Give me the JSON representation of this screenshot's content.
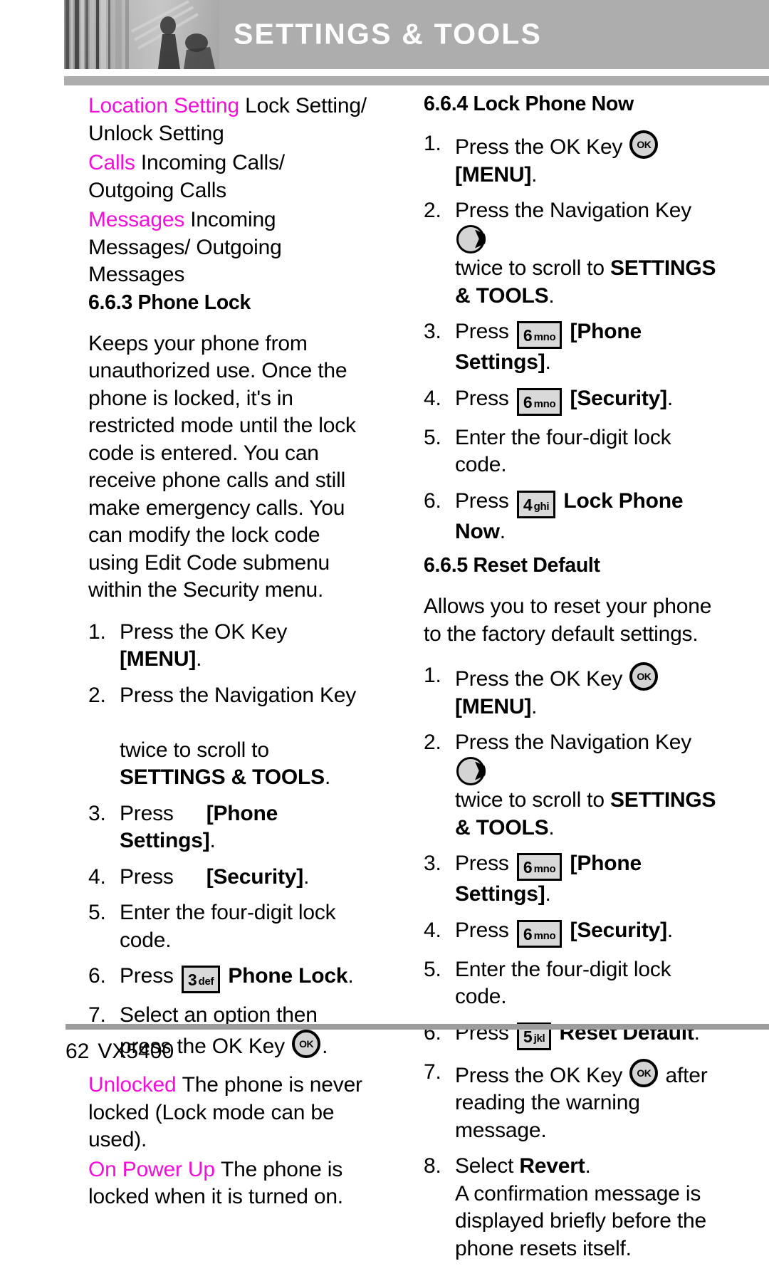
{
  "header": {
    "title": "SETTINGS & TOOLS",
    "photo_alt": "grayscale-photo"
  },
  "left_column": {
    "terms": [
      {
        "term": "Location Setting",
        "definition": "Lock Setting/ Unlock Setting"
      },
      {
        "term": "Calls",
        "definition": "Incoming Calls/ Outgoing Calls"
      },
      {
        "term": "Messages",
        "definition": "Incoming Messages/ Outgoing Messages"
      }
    ],
    "section": {
      "heading": "6.6.3 Phone Lock",
      "body": "Keeps your phone from unauthorized use. Once the phone is locked, it's in restricted mode until the lock code is entered. You can receive phone calls and still make emergency calls. You can modify the lock code using Edit Code submenu within the Security menu.",
      "steps": [
        {
          "num": "1.",
          "pre": "Press the OK Key",
          "icon": "missing-ok-key-icon",
          "post": "[MENU]",
          "post_bold": "[MENU]",
          "tail": "."
        },
        {
          "num": "2.",
          "pre": "Press the Navigation Key",
          "icon": "missing-navigation-key-icon",
          "post": "twice to scroll to",
          "bold_run": "SETTINGS & TOOLS",
          "tail": "."
        },
        {
          "num": "3.",
          "pre": "Press",
          "icon": "missing-key-6-icon",
          "post_bold": "[Phone Settings]",
          "tail": "."
        },
        {
          "num": "4.",
          "pre": "Press",
          "icon": "missing-key-6-icon",
          "post_bold": "[Security]",
          "tail": "."
        },
        {
          "num": "5.",
          "pre": "Enter the four-digit lock code.",
          "icon": "",
          "post_bold": "",
          "tail": ""
        },
        {
          "num": "6.",
          "pre": "Press",
          "icon": "key-3-def",
          "key_digit": "3",
          "key_letters": "def",
          "post_bold": "Phone Lock",
          "tail": "."
        },
        {
          "num": "7.",
          "pre": "Select an option then press the OK Key",
          "icon": "ok-key",
          "post_bold": "",
          "tail": "."
        }
      ]
    },
    "options": [
      {
        "term": "Unlocked",
        "definition": "The phone is never locked (Lock mode can be used)."
      },
      {
        "term": "On Power Up",
        "definition": "The phone is locked when it is turned on."
      }
    ]
  },
  "right_column": {
    "section_lock": {
      "heading": "6.6.4 Lock Phone Now",
      "steps": [
        {
          "num": "1.",
          "pre": "Press the OK Key",
          "icon": "ok-key",
          "post_bold": "[MENU]",
          "tail": "."
        },
        {
          "num": "2.",
          "pre": "Press the Navigation Key",
          "icon": "navigation-key",
          "post": "twice to scroll to",
          "bold_run": "SETTINGS & TOOLS",
          "tail": "."
        },
        {
          "num": "3.",
          "pre": "Press",
          "icon": "key-6-mno",
          "key_digit": "6",
          "key_letters": "mno",
          "post_bold": "[Phone Settings]",
          "tail": "."
        },
        {
          "num": "4.",
          "pre": "Press",
          "icon": "key-6-mno",
          "key_digit": "6",
          "key_letters": "mno",
          "post_bold": "[Security]",
          "tail": "."
        },
        {
          "num": "5.",
          "pre": "Enter the four-digit lock code.",
          "icon": "",
          "post_bold": "",
          "tail": ""
        },
        {
          "num": "6.",
          "pre": "Press",
          "icon": "key-4-ghi",
          "key_digit": "4",
          "key_letters": "ghi",
          "post_bold": "Lock Phone Now",
          "tail": "."
        }
      ]
    },
    "section_reset": {
      "heading": "6.6.5 Reset Default",
      "body": "Allows you to reset your phone to the factory default settings.",
      "steps": [
        {
          "num": "1.",
          "pre": "Press the OK Key",
          "icon": "ok-key",
          "post_bold": "[MENU]",
          "tail": "."
        },
        {
          "num": "2.",
          "pre": "Press the Navigation Key",
          "icon": "navigation-key",
          "post": "twice to scroll to",
          "bold_run": "SETTINGS & TOOLS",
          "tail": "."
        },
        {
          "num": "3.",
          "pre": "Press",
          "icon": "key-6-mno",
          "key_digit": "6",
          "key_letters": "mno",
          "post_bold": "[Phone Settings]",
          "tail": "."
        },
        {
          "num": "4.",
          "pre": "Press",
          "icon": "key-6-mno",
          "key_digit": "6",
          "key_letters": "mno",
          "post_bold": "[Security]",
          "tail": "."
        },
        {
          "num": "5.",
          "pre": "Enter the four-digit lock code.",
          "icon": "",
          "post_bold": "",
          "tail": ""
        },
        {
          "num": "6.",
          "pre": "Press",
          "icon": "key-5-jkl",
          "key_digit": "5",
          "key_letters": "jkl",
          "post_bold": "Reset Default",
          "tail": "."
        },
        {
          "num": "7.",
          "pre": "Press the OK Key",
          "icon": "ok-key",
          "post": "after reading the warning message.",
          "post_bold": "",
          "tail": ""
        },
        {
          "num": "8.",
          "pre": "Select",
          "icon": "",
          "post_bold": "Revert",
          "tail": ".",
          "sub": "A confirmation message is displayed briefly before the phone resets itself."
        }
      ]
    }
  },
  "footer": {
    "page_number": "62",
    "model": "VX5400"
  },
  "colors": {
    "accent_magenta": "#f210d8",
    "header_gray": "#adadad",
    "key_fill": "#d9d9d9",
    "rule_gray": "#9c9c9c"
  },
  "labels": {
    "ok_key_text": "OK"
  }
}
